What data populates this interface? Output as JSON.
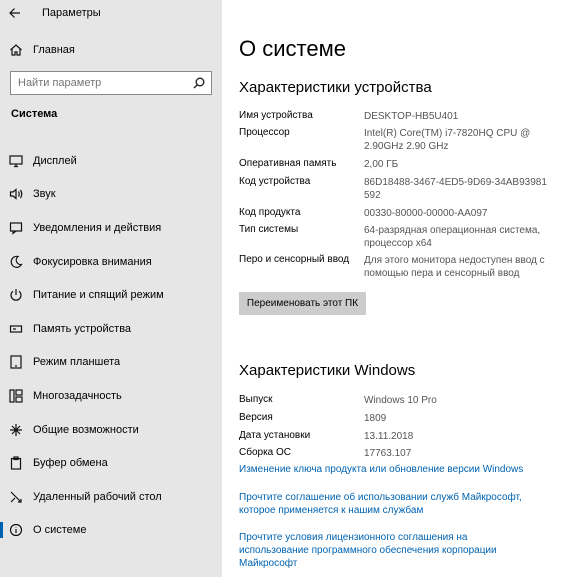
{
  "window": {
    "title": "Параметры"
  },
  "sidebar": {
    "home_label": "Главная",
    "search_placeholder": "Найти параметр",
    "section": "Система",
    "items": [
      {
        "label": "Дисплей",
        "icon": "display-icon"
      },
      {
        "label": "Звук",
        "icon": "speaker-icon"
      },
      {
        "label": "Уведомления и действия",
        "icon": "notification-icon"
      },
      {
        "label": "Фокусировка внимания",
        "icon": "moon-icon"
      },
      {
        "label": "Питание и спящий режим",
        "icon": "power-icon"
      },
      {
        "label": "Память устройства",
        "icon": "storage-icon"
      },
      {
        "label": "Режим планшета",
        "icon": "tablet-icon"
      },
      {
        "label": "Многозадачность",
        "icon": "multitasking-icon"
      },
      {
        "label": "Общие возможности",
        "icon": "shared-experiences-icon"
      },
      {
        "label": "Буфер обмена",
        "icon": "clipboard-icon"
      },
      {
        "label": "Удаленный рабочий стол",
        "icon": "remote-desktop-icon"
      },
      {
        "label": "О системе",
        "icon": "info-icon",
        "active": true
      }
    ]
  },
  "main": {
    "title": "О системе",
    "device_section": {
      "title": "Характеристики устройства",
      "rows": [
        {
          "key": "Имя устройства",
          "value": "DESKTOP-HB5U401"
        },
        {
          "key": "Процессор",
          "value": "Intel(R) Core(TM) i7-7820HQ CPU @ 2.90GHz   2.90 GHz"
        },
        {
          "key": "Оперативная память",
          "value": "2,00 ГБ"
        },
        {
          "key": "Код устройства",
          "value": "86D18488-3467-4ED5-9D69-34AB93981592"
        },
        {
          "key": "Код продукта",
          "value": "00330-80000-00000-AA097"
        },
        {
          "key": "Тип системы",
          "value": "64-разрядная операционная система, процессор x64"
        },
        {
          "key": "Перо и сенсорный ввод",
          "value": "Для этого монитора недоступен ввод с помощью пера и сенсорный ввод"
        }
      ],
      "rename_button": "Переименовать этот ПК"
    },
    "windows_section": {
      "title": "Характеристики Windows",
      "rows": [
        {
          "key": "Выпуск",
          "value": "Windows 10 Pro"
        },
        {
          "key": "Версия",
          "value": "1809"
        },
        {
          "key": "Дата установки",
          "value": "13.11.2018"
        },
        {
          "key": "Сборка ОС",
          "value": "17763.107"
        }
      ],
      "links": [
        "Изменение ключа продукта или обновление версии Windows",
        "Прочтите соглашение об использовании служб Майкрософт, которое применяется к нашим службам",
        "Прочтите условия лицензионного соглашения на использование программного обеспечения корпорации Майкрософт"
      ]
    }
  },
  "colors": {
    "accent": "#0063b1",
    "sidebar_bg": "#e6e6e6",
    "button_bg": "#cccccc"
  }
}
